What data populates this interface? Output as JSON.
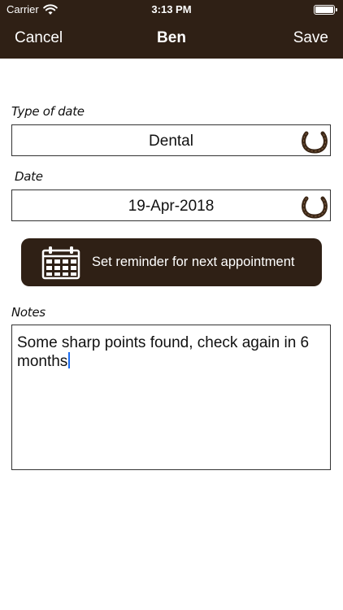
{
  "status_bar": {
    "carrier": "Carrier",
    "time": "3:13 PM"
  },
  "nav": {
    "cancel_label": "Cancel",
    "title": "Ben",
    "save_label": "Save"
  },
  "form": {
    "type_label": "Type of date",
    "type_value": "Dental",
    "date_label": "Date",
    "date_value": "19-Apr-2018",
    "reminder_label": "Set reminder for next appointment",
    "notes_label": "Notes",
    "notes_value": "Some sharp points found, check again in 6 months"
  },
  "colors": {
    "brand_brown": "#2f2015",
    "caret_blue": "#1a6cf0"
  },
  "icons": [
    "wifi-icon",
    "battery-icon",
    "horseshoe-icon",
    "calendar-icon"
  ]
}
